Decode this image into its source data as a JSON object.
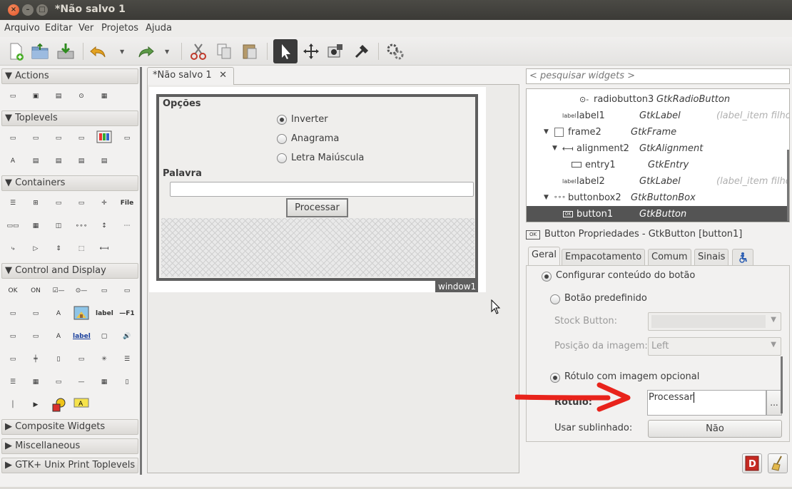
{
  "window": {
    "title": "*Não salvo 1"
  },
  "menu": [
    "Arquivo",
    "Editar",
    "Ver",
    "Projetos",
    "Ajuda"
  ],
  "toolbar": [
    "new-icon",
    "open-icon",
    "save-icon",
    "undo-icon",
    "redo-icon",
    "cut-icon",
    "copy-icon",
    "paste-icon",
    "select-pointer-icon",
    "drag-resize-icon",
    "widget-prop-icon",
    "pin-icon",
    "preferences-icon"
  ],
  "palette": {
    "groups": [
      "Actions",
      "Toplevels",
      "Containers",
      "Control and Display",
      "Composite Widgets",
      "Miscellaneous",
      "GTK+ Unix Print Toplevels"
    ],
    "icon_texts": {
      "file": "File",
      "on": "ON",
      "ok": "OK",
      "label": "label",
      "f1": "—F1"
    }
  },
  "document_tab": {
    "label": "*Não salvo 1",
    "close": "✕"
  },
  "design": {
    "frame1_label": "Opções",
    "radios": [
      "Inverter",
      "Anagrama",
      "Letra Maiúscula"
    ],
    "frame2_label": "Palavra",
    "button_label": "Processar",
    "window_tag": "window1"
  },
  "inspector": {
    "search_placeholder": "< pesquisar widgets >",
    "rows": [
      {
        "name": "radiobutton3",
        "class": "GtkRadioButton",
        "note": ""
      },
      {
        "name": "label1",
        "class": "GtkLabel",
        "note": "(label_item filho"
      },
      {
        "name": "frame2",
        "class": "GtkFrame",
        "note": ""
      },
      {
        "name": "alignment2",
        "class": "GtkAlignment",
        "note": ""
      },
      {
        "name": "entry1",
        "class": "GtkEntry",
        "note": ""
      },
      {
        "name": "label2",
        "class": "GtkLabel",
        "note": "(label_item filho"
      },
      {
        "name": "buttonbox2",
        "class": "GtkButtonBox",
        "note": ""
      },
      {
        "name": "button1",
        "class": "GtkButton",
        "note": ""
      }
    ],
    "label_icon_text": "label",
    "ok_icon_text": "OK"
  },
  "properties": {
    "header": "Button Propriedades - GtkButton [button1]",
    "tabs": [
      "Geral",
      "Empacotamento",
      "Comum",
      "Sinais"
    ],
    "configure_content": "Configurar conteúdo do botão",
    "predefined_button": "Botão predefinido",
    "stock_button_label": "Stock Button:",
    "image_position_label": "Posição da imagem:",
    "image_position_value": "Left",
    "label_with_image": "Rótulo com imagem opcional",
    "label_field_label": "Rótulo:",
    "label_field_value": "Processar",
    "dots": "...",
    "use_underline_label": "Usar sublinhado:",
    "use_underline_value": "Não"
  },
  "colors": {
    "title_bar": "#3c3b37",
    "close_button": "#e2532a",
    "selection": "#545454",
    "annotation_arrow": "#e8231b"
  }
}
